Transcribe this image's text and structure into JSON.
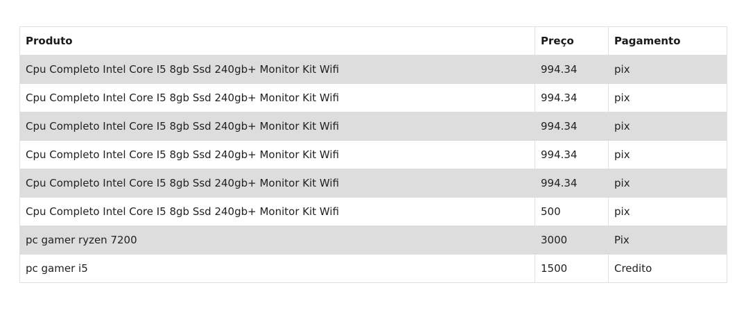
{
  "table": {
    "headers": [
      "Produto",
      "Preço",
      "Pagamento"
    ],
    "rows": [
      [
        "Cpu Completo Intel Core I5 8gb Ssd 240gb+ Monitor Kit Wifi",
        "994.34",
        "pix"
      ],
      [
        "Cpu Completo Intel Core I5 8gb Ssd 240gb+ Monitor Kit Wifi",
        "994.34",
        "pix"
      ],
      [
        "Cpu Completo Intel Core I5 8gb Ssd 240gb+ Monitor Kit Wifi",
        "994.34",
        "pix"
      ],
      [
        "Cpu Completo Intel Core I5 8gb Ssd 240gb+ Monitor Kit Wifi",
        "994.34",
        "pix"
      ],
      [
        "Cpu Completo Intel Core I5 8gb Ssd 240gb+ Monitor Kit Wifi",
        "994.34",
        "pix"
      ],
      [
        "Cpu Completo Intel Core I5 8gb Ssd 240gb+ Monitor Kit Wifi",
        "500",
        "pix"
      ],
      [
        "pc gamer ryzen 7200",
        "3000",
        "Pix"
      ],
      [
        "pc gamer i5",
        "1500",
        "Credito"
      ]
    ]
  },
  "colors": {
    "stripe": "#dddddd",
    "border": "#e0e0e0",
    "background": "#ffffff",
    "text": "#212121"
  }
}
